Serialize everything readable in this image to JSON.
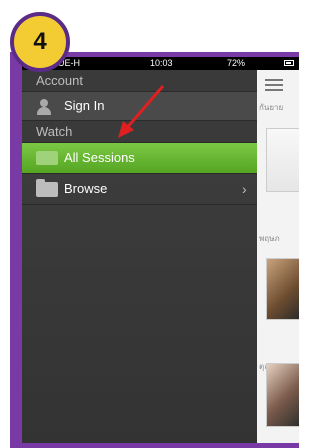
{
  "badge": "4",
  "statusbar": {
    "carrier": "UE-H",
    "time": "10:03",
    "battery": "72%"
  },
  "menu": {
    "sections": [
      {
        "title": "Account",
        "items": [
          {
            "label": "Sign In",
            "icon": "person-icon"
          }
        ]
      },
      {
        "title": "Watch",
        "items": [
          {
            "label": "All Sessions",
            "icon": "film-icon",
            "selected": true
          },
          {
            "label": "Browse",
            "icon": "folder-icon",
            "chevron": "›"
          }
        ]
      }
    ]
  },
  "content": {
    "month_labels": [
      "กันยาย",
      "พฤษภ",
      "ตุลาคม"
    ]
  },
  "colors": {
    "frame": "#7a3aa6",
    "badge": "#f2cc32",
    "selected": "#6fbf3a",
    "arrow": "#e02020"
  }
}
